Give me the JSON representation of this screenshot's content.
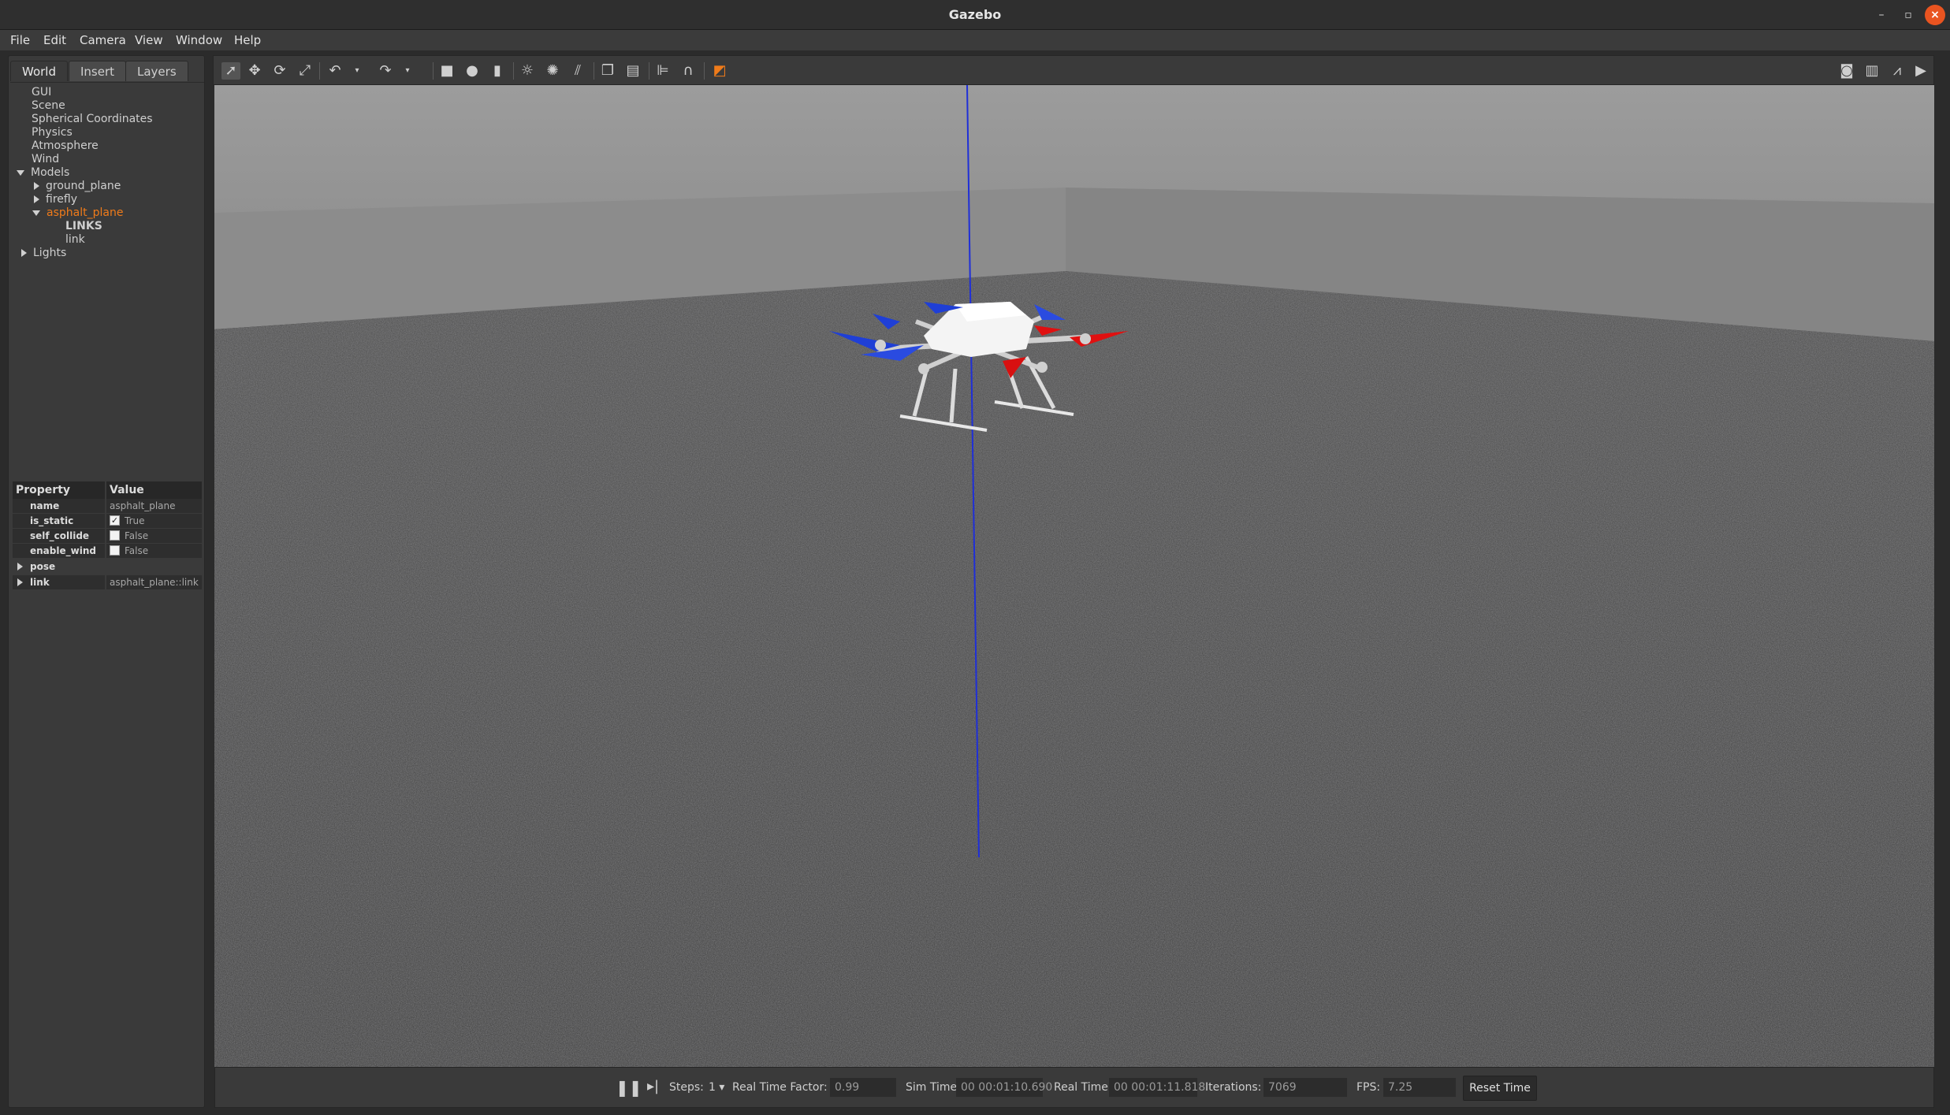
{
  "window": {
    "title": "Gazebo"
  },
  "menu": [
    "File",
    "Edit",
    "Camera",
    "View",
    "Window",
    "Help"
  ],
  "tabs": [
    "World",
    "Insert",
    "Layers"
  ],
  "tree": {
    "gui": "GUI",
    "scene": "Scene",
    "spherical": "Spherical Coordinates",
    "physics": "Physics",
    "atmosphere": "Atmosphere",
    "wind": "Wind",
    "models": "Models",
    "ground_plane": "ground_plane",
    "firefly": "firefly",
    "asphalt_plane": "asphalt_plane",
    "links": "LINKS",
    "link": "link",
    "lights": "Lights"
  },
  "properties": {
    "header": {
      "name": "Property",
      "value": "Value"
    },
    "rows": [
      {
        "name": "name",
        "value": "asphalt_plane"
      },
      {
        "name": "is_static",
        "value": "True",
        "checked": true
      },
      {
        "name": "self_collide",
        "value": "False",
        "checked": false
      },
      {
        "name": "enable_wind",
        "value": "False",
        "checked": false
      },
      {
        "name": "pose",
        "value": ""
      },
      {
        "name": "link",
        "value": "asphalt_plane::link"
      }
    ]
  },
  "toolbar_icons": [
    "select-icon",
    "translate-icon",
    "rotate-icon",
    "scale-icon",
    "undo-icon",
    "redo-icon",
    "box-icon",
    "sphere-icon",
    "cylinder-icon",
    "point-light-icon",
    "spot-light-icon",
    "directional-light-icon",
    "copy-icon",
    "paste-icon",
    "align-icon",
    "snap-icon",
    "view-angle-icon",
    "screenshot-icon",
    "log-icon",
    "plot-icon",
    "video-icon"
  ],
  "status": {
    "steps_label": "Steps:",
    "steps_value": "1",
    "rtf_label": "Real Time Factor:",
    "rtf_value": "0.99",
    "sim_time_label": "Sim Time:",
    "sim_time_value": "00 00:01:10.690",
    "real_time_label": "Real Time:",
    "real_time_value": "00 00:01:11.818",
    "iterations_label": "Iterations:",
    "iterations_value": "7069",
    "fps_label": "FPS:",
    "fps_value": "7.25",
    "reset_label": "Reset Time"
  },
  "colors": {
    "accent": "#ef7b1a",
    "close": "#e95420",
    "axis": "#1f2fd8"
  }
}
